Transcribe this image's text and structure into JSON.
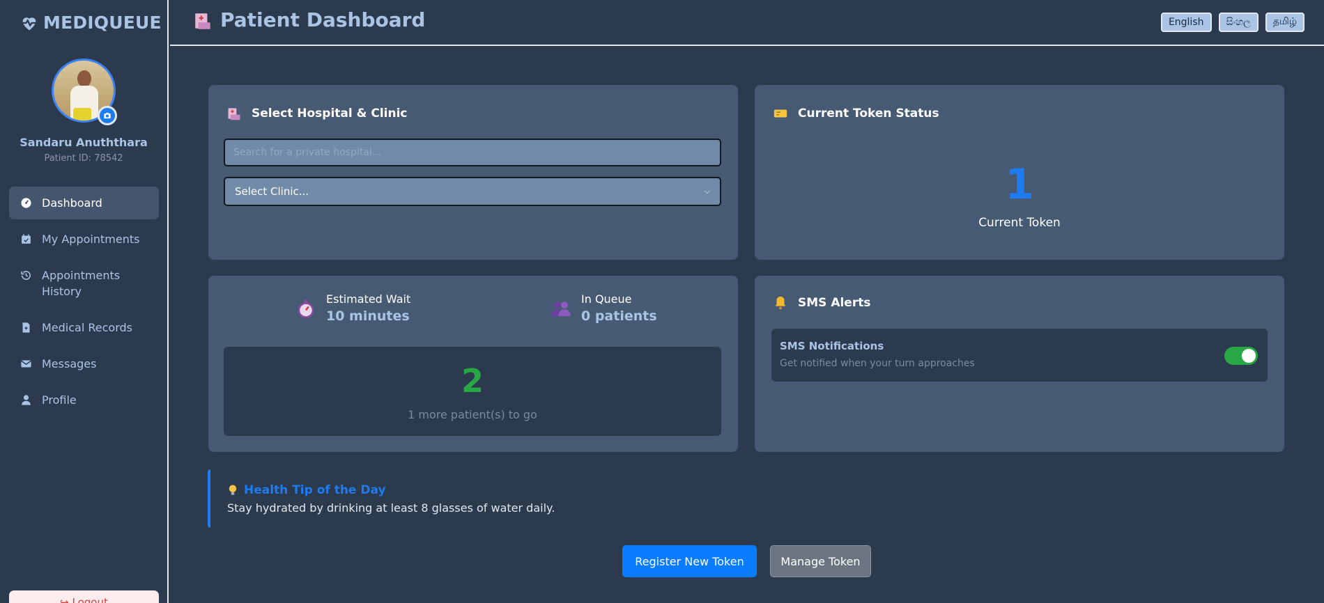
{
  "brand": {
    "name": "MEDIQUEUE"
  },
  "user": {
    "name": "Sandaru Anuththara",
    "patient_id": "Patient ID: 78542"
  },
  "sidebar": {
    "items": [
      {
        "label": "Dashboard",
        "icon": "dashboard-gauge-icon",
        "active": true
      },
      {
        "label": "My Appointments",
        "icon": "calendar-check-icon"
      },
      {
        "label": "Appointments History",
        "icon": "history-icon"
      },
      {
        "label": "Medical Records",
        "icon": "file-medical-icon"
      },
      {
        "label": "Messages",
        "icon": "envelope-icon"
      },
      {
        "label": "Profile",
        "icon": "user-icon"
      }
    ],
    "logout_label": "Logout"
  },
  "header": {
    "title": "Patient Dashboard",
    "languages": [
      "English",
      "සිංහල",
      "தமிழ்"
    ]
  },
  "hospital_card": {
    "title": "Select Hospital & Clinic",
    "search_placeholder": "Search for a private hospital...",
    "clinic_select": "Select Clinic..."
  },
  "token_card": {
    "title": "Current Token Status",
    "token_number": "1",
    "token_label": "Current Token"
  },
  "queue_card": {
    "wait_label": "Estimated Wait",
    "wait_value": "10 minutes",
    "queue_label": "In Queue",
    "queue_value": "0 patients",
    "remaining_number": "2",
    "remaining_text": "1 more patient(s) to go"
  },
  "sms_card": {
    "title": "SMS Alerts",
    "notif_title": "SMS Notifications",
    "notif_subtitle": "Get notified when your turn approaches",
    "enabled": true
  },
  "tip": {
    "title": "Health Tip of the Day",
    "text": "Stay hydrated by drinking at least 8 glasses of water daily."
  },
  "actions": {
    "register_label": "Register New Token",
    "manage_label": "Manage Token"
  },
  "colors": {
    "background": "#2c3a4e",
    "card": "#475a73",
    "accent": "#1d7cf2",
    "success": "#28a745",
    "muted_text": "#aac4e6"
  }
}
